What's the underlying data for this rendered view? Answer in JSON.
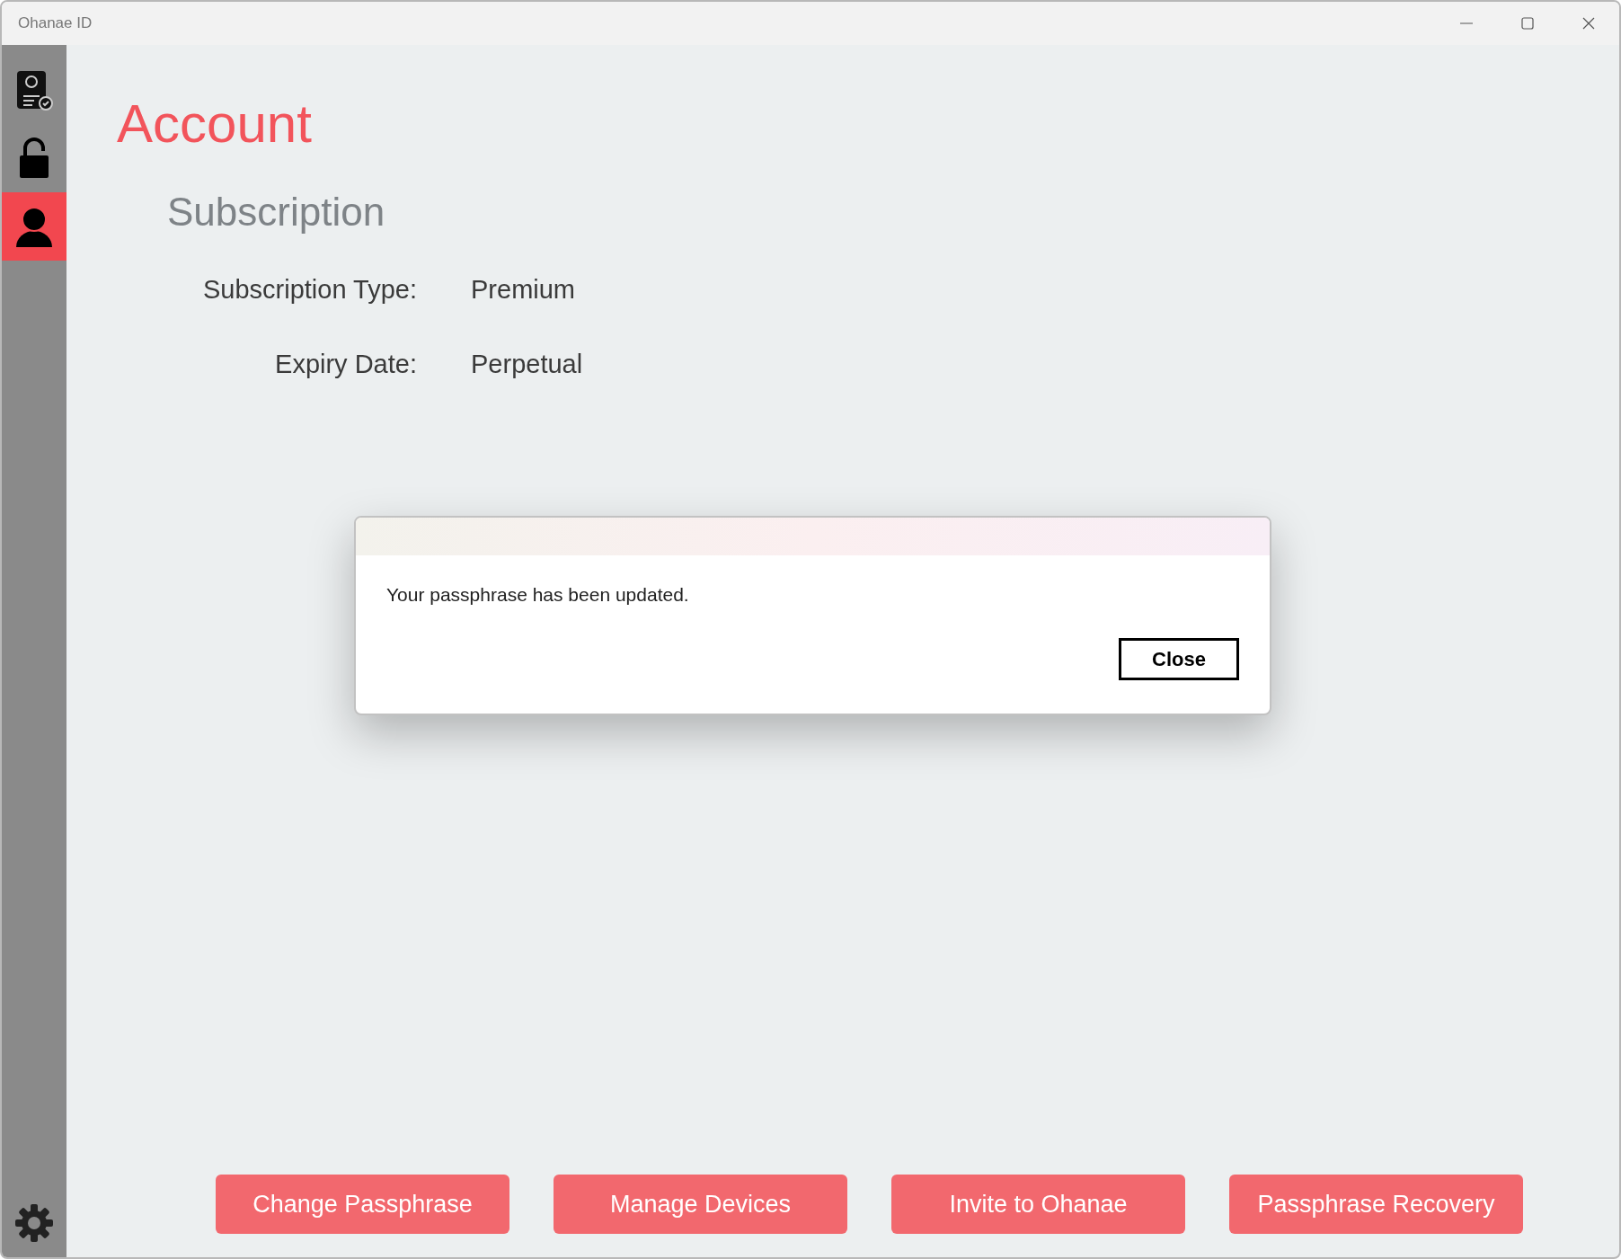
{
  "window": {
    "title": "Ohanae ID"
  },
  "sidebar": {
    "items": [
      {
        "kind": "identity",
        "selected": false
      },
      {
        "kind": "lock",
        "selected": false
      },
      {
        "kind": "account",
        "selected": true
      }
    ]
  },
  "page": {
    "title": "Account",
    "section": "Subscription",
    "fields": [
      {
        "label": "Subscription Type:",
        "value": "Premium"
      },
      {
        "label": "Expiry Date:",
        "value": "Perpetual"
      }
    ]
  },
  "actions": [
    "Change Passphrase",
    "Manage Devices",
    "Invite to Ohanae",
    "Passphrase Recovery"
  ],
  "dialog": {
    "message": "Your passphrase has been updated.",
    "button": "Close"
  }
}
